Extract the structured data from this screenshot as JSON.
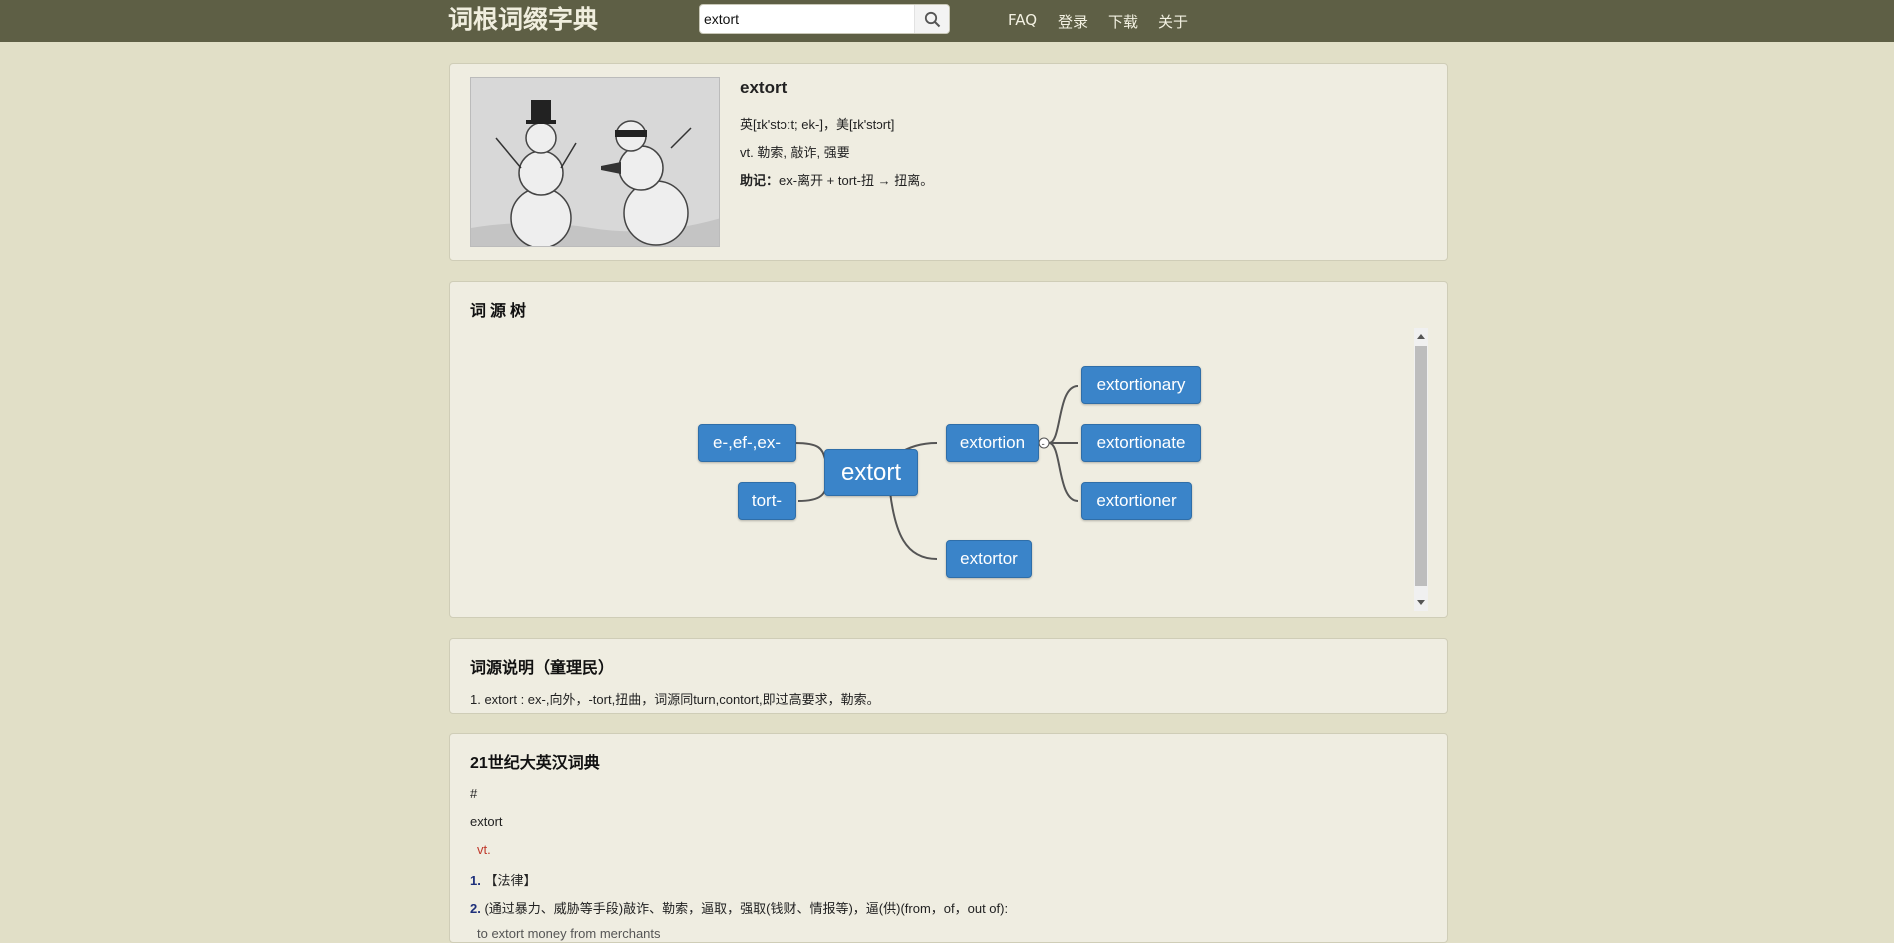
{
  "header": {
    "logo": "词根词缀字典",
    "search_value": "extort",
    "nav": [
      "FAQ",
      "登录",
      "下载",
      "关于"
    ]
  },
  "word": {
    "title": "extort",
    "pron": "英[ɪk'stɔːt; ek-]，美[ɪk'stɔrt]",
    "pos_def": "vt. 勒索, 敲诈, 强要",
    "mnemonic_label": "助记：",
    "mnemonic_text": "ex-离开 + tort-扭 → 扭离。"
  },
  "tree": {
    "title": "词源树",
    "nodes": {
      "root": "extort",
      "prefix": "e-,ef-,ex-",
      "tort": "tort-",
      "extortion": "extortion",
      "extortor": "extortor",
      "extortionary": "extortionary",
      "extortionate": "extortionate",
      "extortioner": "extortioner"
    },
    "collapse_symbol": "-"
  },
  "etymology": {
    "title": "词源说明（童理民）",
    "text": "1. extort : ex-,向外，-tort,扭曲，词源同turn,contort,即过高要求，勒索。"
  },
  "dictionary": {
    "title": "21世纪大英汉词典",
    "lines": {
      "hash": "#",
      "word": "extort",
      "pos": "vt.",
      "def1_num": "1.",
      "def1_text": "【法律】",
      "def2_num": "2.",
      "def2_text": "(通过暴力、威胁等手段)敲诈、勒索，逼取，强取(钱财、情报等)，逼(供)(from，of，out of):",
      "example": "to extort money from merchants"
    }
  },
  "colors": {
    "topbar": "#5e5f45",
    "background": "#e1dfc7",
    "card": "#efede1",
    "node": "#3a84c9",
    "pos_red": "#c0392b"
  }
}
